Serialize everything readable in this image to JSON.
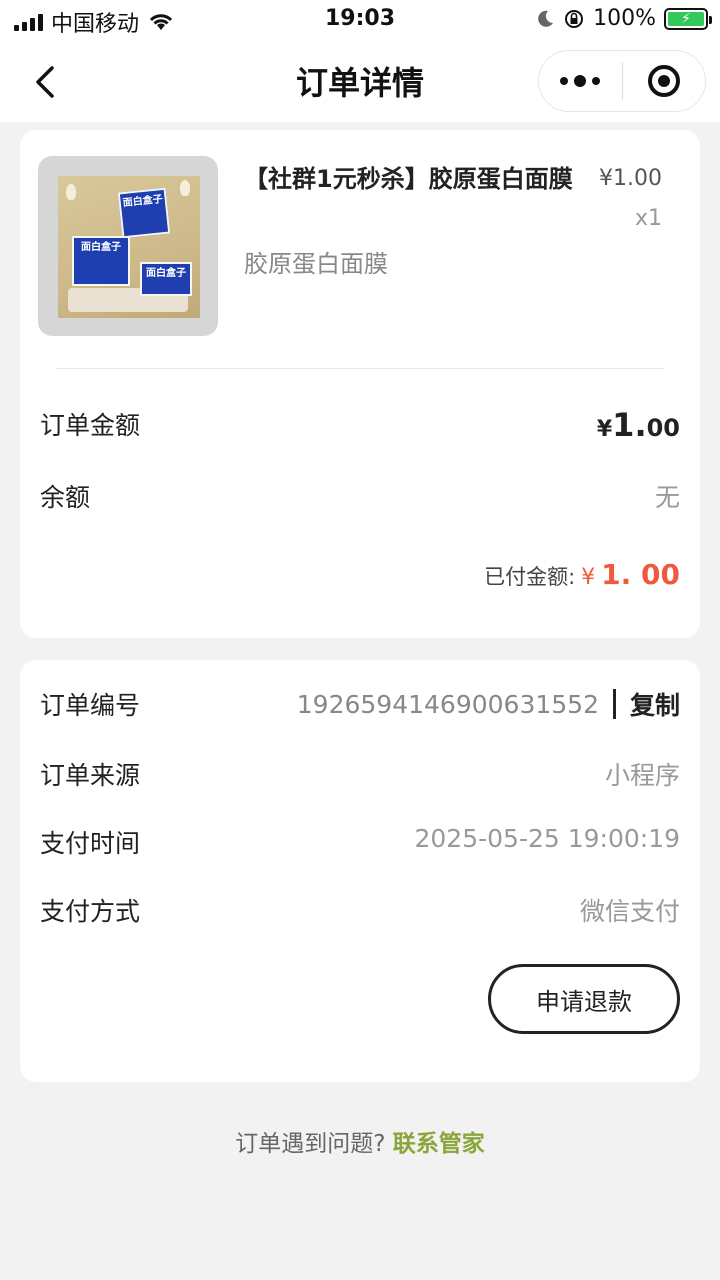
{
  "status_bar": {
    "carrier": "中国移动",
    "time": "19:03",
    "battery": "100%"
  },
  "nav": {
    "title": "订单详情",
    "back_icon": "chevron-left-icon",
    "more_icon": "more-dots-icon",
    "close_icon": "target-close-icon"
  },
  "product": {
    "title": "【社群1元秒杀】胶原蛋白面膜",
    "spec": "胶原蛋白面膜",
    "price": "¥1.00",
    "quantity": "x1",
    "image_box_text": "面白盒子"
  },
  "summary": {
    "order_amount_label": "订单金额",
    "order_amount_currency": "¥",
    "order_amount_int": "1.",
    "order_amount_dec": "00",
    "balance_label": "余额",
    "balance_value": "无",
    "paid_label": "已付金额:",
    "paid_currency": "¥",
    "paid_amount": "1. 00"
  },
  "details": {
    "order_no_label": "订单编号",
    "order_no_value": "1926594146900631552",
    "copy_label": "复制",
    "source_label": "订单来源",
    "source_value": "小程序",
    "pay_time_label": "支付时间",
    "pay_time_value": "2025-05-25 19:00:19",
    "pay_method_label": "支付方式",
    "pay_method_value": "微信支付",
    "refund_button": "申请退款"
  },
  "footer": {
    "question": "订单遇到问题?",
    "contact_link": "联系管家"
  },
  "colors": {
    "accent_price": "#ef5a3c",
    "link_green": "#8aa53a",
    "battery_green": "#34c759"
  }
}
